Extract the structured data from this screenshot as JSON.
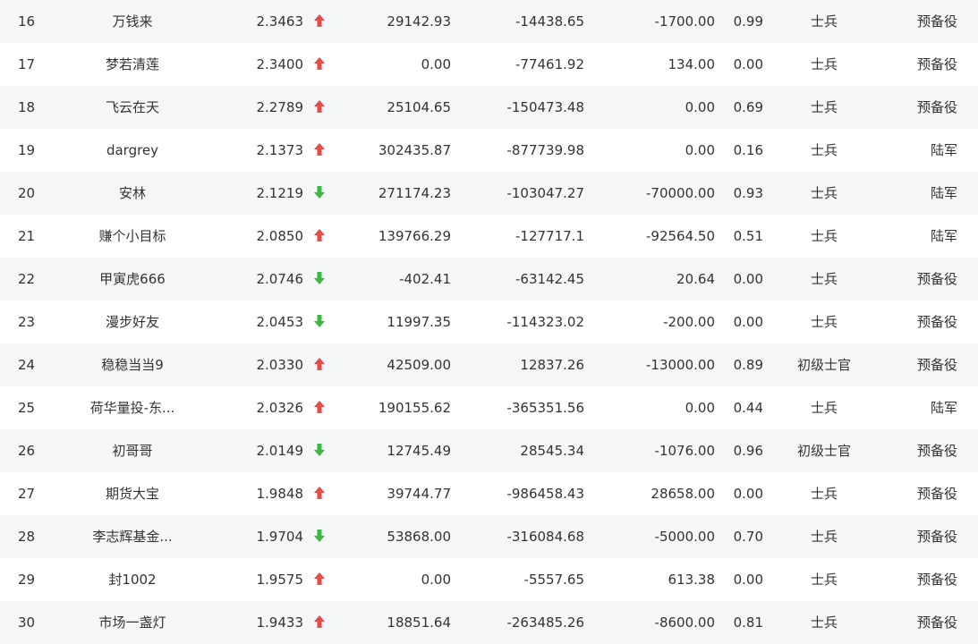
{
  "colors": {
    "up": "#e84a4a",
    "down": "#3cb93c",
    "stripe": "#f5f6f8",
    "text": "#333333"
  },
  "rows": [
    {
      "rank": "16",
      "name": "万钱来",
      "score": "2.3463",
      "trend": "up",
      "v1": "29142.93",
      "v2": "-14438.65",
      "v3": "-1700.00",
      "v4": "0.99",
      "rank_title": "士兵",
      "army": "预备役"
    },
    {
      "rank": "17",
      "name": "梦若清莲",
      "score": "2.3400",
      "trend": "up",
      "v1": "0.00",
      "v2": "-77461.92",
      "v3": "134.00",
      "v4": "0.00",
      "rank_title": "士兵",
      "army": "预备役"
    },
    {
      "rank": "18",
      "name": "飞云在天",
      "score": "2.2789",
      "trend": "up",
      "v1": "25104.65",
      "v2": "-150473.48",
      "v3": "0.00",
      "v4": "0.69",
      "rank_title": "士兵",
      "army": "预备役"
    },
    {
      "rank": "19",
      "name": "dargrey",
      "score": "2.1373",
      "trend": "up",
      "v1": "302435.87",
      "v2": "-877739.98",
      "v3": "0.00",
      "v4": "0.16",
      "rank_title": "士兵",
      "army": "陆军"
    },
    {
      "rank": "20",
      "name": "安林",
      "score": "2.1219",
      "trend": "down",
      "v1": "271174.23",
      "v2": "-103047.27",
      "v3": "-70000.00",
      "v4": "0.93",
      "rank_title": "士兵",
      "army": "陆军"
    },
    {
      "rank": "21",
      "name": "赚个小目标",
      "score": "2.0850",
      "trend": "up",
      "v1": "139766.29",
      "v2": "-127717.1",
      "v3": "-92564.50",
      "v4": "0.51",
      "rank_title": "士兵",
      "army": "陆军"
    },
    {
      "rank": "22",
      "name": "甲寅虎666",
      "score": "2.0746",
      "trend": "down",
      "v1": "-402.41",
      "v2": "-63142.45",
      "v3": "20.64",
      "v4": "0.00",
      "rank_title": "士兵",
      "army": "预备役"
    },
    {
      "rank": "23",
      "name": "漫步好友",
      "score": "2.0453",
      "trend": "down",
      "v1": "11997.35",
      "v2": "-114323.02",
      "v3": "-200.00",
      "v4": "0.00",
      "rank_title": "士兵",
      "army": "预备役"
    },
    {
      "rank": "24",
      "name": "稳稳当当9",
      "score": "2.0330",
      "trend": "up",
      "v1": "42509.00",
      "v2": "12837.26",
      "v3": "-13000.00",
      "v4": "0.89",
      "rank_title": "初级士官",
      "army": "预备役"
    },
    {
      "rank": "25",
      "name": "荷华量投-东...",
      "score": "2.0326",
      "trend": "up",
      "v1": "190155.62",
      "v2": "-365351.56",
      "v3": "0.00",
      "v4": "0.44",
      "rank_title": "士兵",
      "army": "陆军"
    },
    {
      "rank": "26",
      "name": "初哥哥",
      "score": "2.0149",
      "trend": "down",
      "v1": "12745.49",
      "v2": "28545.34",
      "v3": "-1076.00",
      "v4": "0.96",
      "rank_title": "初级士官",
      "army": "预备役"
    },
    {
      "rank": "27",
      "name": "期货大宝",
      "score": "1.9848",
      "trend": "up",
      "v1": "39744.77",
      "v2": "-986458.43",
      "v3": "28658.00",
      "v4": "0.00",
      "rank_title": "士兵",
      "army": "预备役"
    },
    {
      "rank": "28",
      "name": "李志辉基金...",
      "score": "1.9704",
      "trend": "down",
      "v1": "53868.00",
      "v2": "-316084.68",
      "v3": "-5000.00",
      "v4": "0.70",
      "rank_title": "士兵",
      "army": "预备役"
    },
    {
      "rank": "29",
      "name": "封1002",
      "score": "1.9575",
      "trend": "up",
      "v1": "0.00",
      "v2": "-5557.65",
      "v3": "613.38",
      "v4": "0.00",
      "rank_title": "士兵",
      "army": "预备役"
    },
    {
      "rank": "30",
      "name": "市场一盏灯",
      "score": "1.9433",
      "trend": "up",
      "v1": "18851.64",
      "v2": "-263485.26",
      "v3": "-8600.00",
      "v4": "0.81",
      "rank_title": "士兵",
      "army": "预备役"
    }
  ]
}
